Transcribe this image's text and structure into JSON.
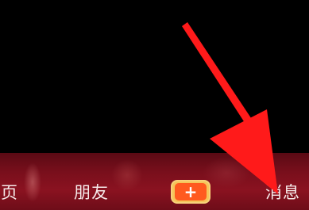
{
  "tabbar": {
    "home_label": "首页",
    "friends_label": "朋友",
    "create_label": "+",
    "messages_label": "消息"
  },
  "colors": {
    "background": "#000000",
    "tabbar": "#7a0f1c",
    "plus_border": "#f6c55a",
    "plus_fill": "#ff5a1f",
    "arrow": "#ff1a1a",
    "tab_text": "#f6e9e9"
  },
  "annotation": {
    "arrow_icon": "red-arrow-icon"
  }
}
